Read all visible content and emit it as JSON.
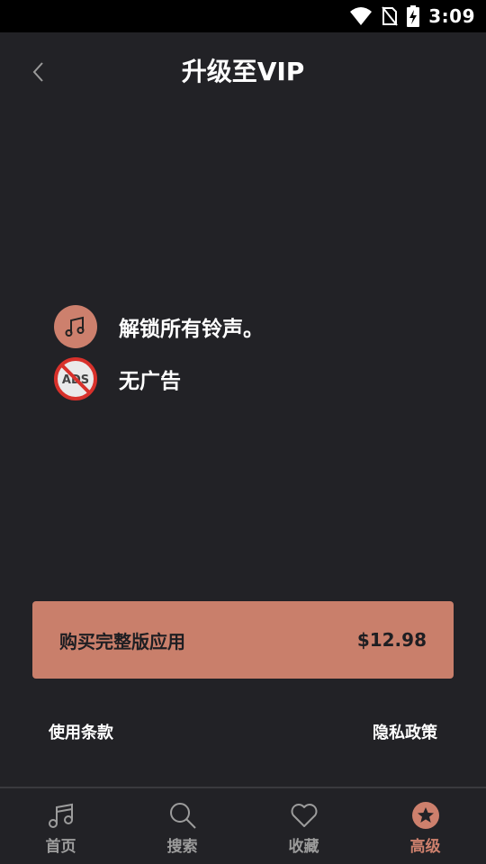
{
  "status_bar": {
    "time": "3:09"
  },
  "header": {
    "title": "升级至VIP"
  },
  "features": [
    {
      "label": "解锁所有铃声。",
      "icon": "music-note-icon"
    },
    {
      "label": "无广告",
      "icon": "no-ads-icon",
      "icon_text": "ADS"
    }
  ],
  "purchase": {
    "label": "购买完整版应用",
    "price": "$12.98"
  },
  "links": {
    "terms": "使用条款",
    "privacy": "隐私政策"
  },
  "nav": {
    "active_index": 3,
    "items": [
      {
        "label": "首页",
        "icon": "music-note-icon"
      },
      {
        "label": "搜索",
        "icon": "search-icon"
      },
      {
        "label": "收藏",
        "icon": "heart-icon"
      },
      {
        "label": "高级",
        "icon": "star-badge-icon"
      }
    ]
  },
  "colors": {
    "accent": "#cd806d",
    "button_bg": "#c97f6b",
    "background": "#222226",
    "no_ads_red": "#d8312b"
  }
}
